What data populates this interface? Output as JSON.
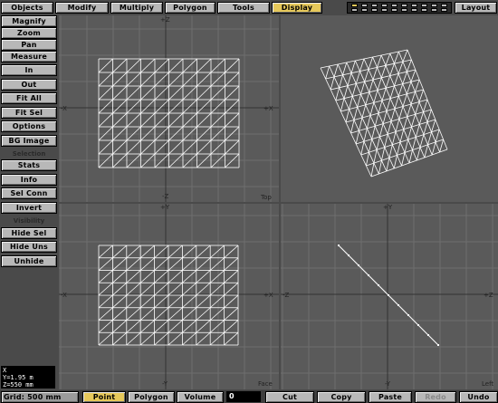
{
  "tabs": [
    {
      "label": "Objects",
      "active": false
    },
    {
      "label": "Modify",
      "active": false
    },
    {
      "label": "Multiply",
      "active": false
    },
    {
      "label": "Polygon",
      "active": false
    },
    {
      "label": "Tools",
      "active": false
    },
    {
      "label": "Display",
      "active": true
    }
  ],
  "layout_button": "Layout",
  "sidebar": {
    "display_buttons": [
      "Magnify",
      "Zoom",
      "Pan",
      "Measure",
      "In",
      "Out",
      "Fit All",
      "Fit Sel",
      "Options",
      "BG Image"
    ],
    "selection_label": "Selection",
    "selection_buttons": [
      "Stats",
      "Info",
      "Sel Conn",
      "Invert"
    ],
    "visibility_label": "Visibility",
    "visibility_buttons": [
      "Hide Sel",
      "Hide Uns",
      "Unhide"
    ]
  },
  "viewports": {
    "top": {
      "name": "Top",
      "up": "+Z",
      "down": "-Z",
      "left": "-X",
      "right": "+X"
    },
    "perspective": {
      "name": ""
    },
    "face": {
      "name": "Face",
      "up": "+Y",
      "down": "-Y",
      "left": "-X",
      "right": "+X"
    },
    "left": {
      "name": "Left",
      "up": "+Y",
      "down": "-Y",
      "left": "-Z",
      "right": "+Z"
    }
  },
  "coords": {
    "x": "X",
    "y": "Y=1.95 m",
    "z": "Z=550 mm"
  },
  "status": {
    "grid": "Grid: 500 mm",
    "modes": [
      {
        "label": "Point",
        "active": true
      },
      {
        "label": "Polygon",
        "active": false
      },
      {
        "label": "Volume",
        "active": false
      }
    ],
    "numeric": "0",
    "actions": [
      {
        "label": "Cut",
        "disabled": false
      },
      {
        "label": "Copy",
        "disabled": false
      },
      {
        "label": "Paste",
        "disabled": false
      },
      {
        "label": "Redo",
        "disabled": true
      },
      {
        "label": "Undo",
        "disabled": false
      }
    ]
  },
  "colors": {
    "viewport_bg": "#5a5a5a",
    "grid": "#6e6e6e",
    "mesh": "#ffffff",
    "active": "#e6c85a",
    "button": "#b8b8b8"
  }
}
